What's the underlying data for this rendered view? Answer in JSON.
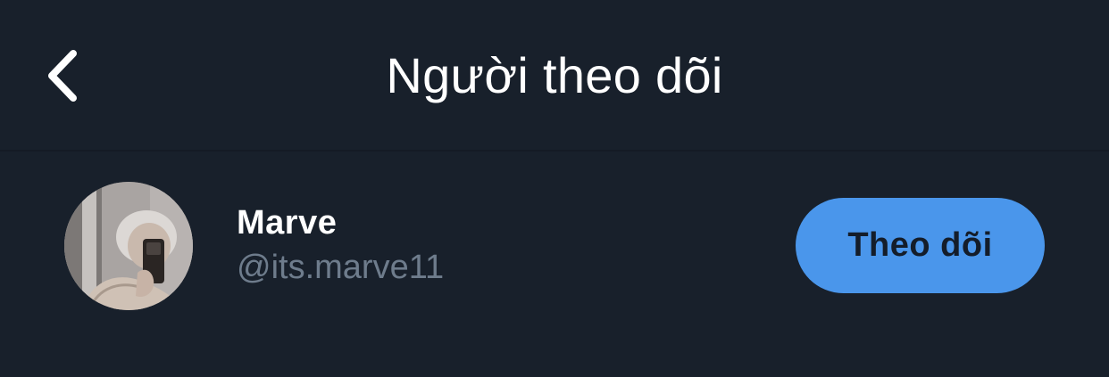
{
  "header": {
    "title": "Người theo dõi",
    "back_icon": "chevron-left-icon"
  },
  "followers": [
    {
      "display_name": "Marve",
      "handle": "@its.marve11",
      "avatar": "profile-photo",
      "follow_label": "Theo dõi"
    }
  ],
  "colors": {
    "background": "#18202b",
    "title_text": "#ffffff",
    "handle_text": "#6e7c8c",
    "follow_button": "#4a96eb",
    "follow_button_text": "#141d2a"
  }
}
